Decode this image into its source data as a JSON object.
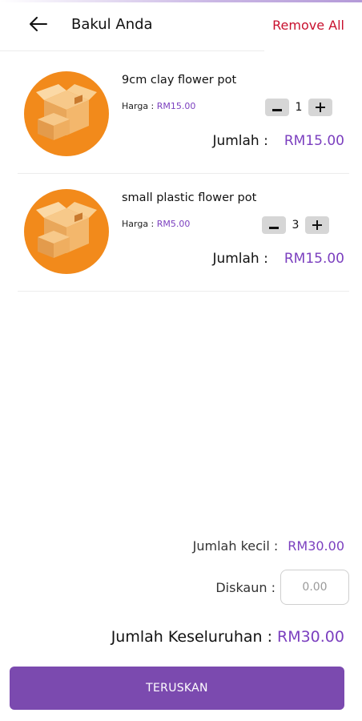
{
  "header": {
    "title": "Bakul Anda",
    "remove_all": "Remove All",
    "back_icon": "arrow-left-icon"
  },
  "cart": {
    "items": [
      {
        "name": "9cm clay flower pot",
        "price_label": "Harga : ",
        "price": "RM15.00",
        "quantity": "1",
        "total_label": "Jumlah :",
        "total": "RM15.00",
        "image_icon": "box-icon"
      },
      {
        "name": "small plastic flower pot",
        "price_label": "Harga : ",
        "price": "RM5.00",
        "quantity": "3",
        "total_label": "Jumlah :",
        "total": "RM15.00",
        "image_icon": "box-icon"
      }
    ],
    "minus_icon": "minus-icon",
    "plus_icon": "plus-icon"
  },
  "summary": {
    "subtotal_label": "Jumlah kecil :",
    "subtotal": "RM30.00",
    "discount_label": "Diskaun :",
    "discount_placeholder": "0.00",
    "grand_total_label": "Jumlah Keseluruhan :",
    "grand_total": "RM30.00"
  },
  "footer": {
    "continue_label": "TERUSKAN"
  },
  "colors": {
    "accent": "#7b3fbf",
    "button": "#7b4aaf",
    "danger": "#c8102e",
    "thumb_bg": "#f28a1b"
  }
}
